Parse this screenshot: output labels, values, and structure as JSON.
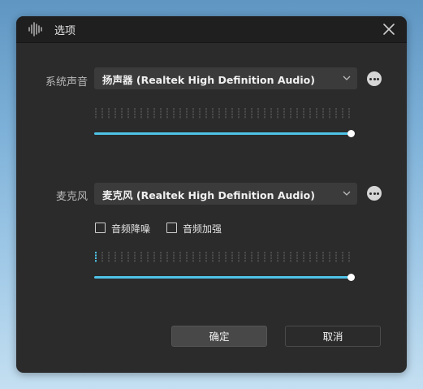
{
  "window": {
    "title": "选项",
    "app_icon": "audio-waveform-icon",
    "close_icon": "close-icon"
  },
  "system_sound": {
    "label": "系统声音",
    "device": "扬声器 (Realtek High Definition Audio)",
    "level_segments_active": 0,
    "volume": 1.0
  },
  "microphone": {
    "label": "麦克风",
    "device": "麦克风 (Realtek High Definition Audio)",
    "noise_reduction_label": "音频降噪",
    "noise_reduction_checked": false,
    "enhance_label": "音频加强",
    "enhance_checked": false,
    "level_segments_active": 1,
    "volume": 1.0
  },
  "buttons": {
    "ok": "确定",
    "cancel": "取消"
  },
  "colors": {
    "accent": "#4fc3e8",
    "dialog_bg": "#2b2b2b",
    "titlebar_bg": "#1f1f1f"
  }
}
